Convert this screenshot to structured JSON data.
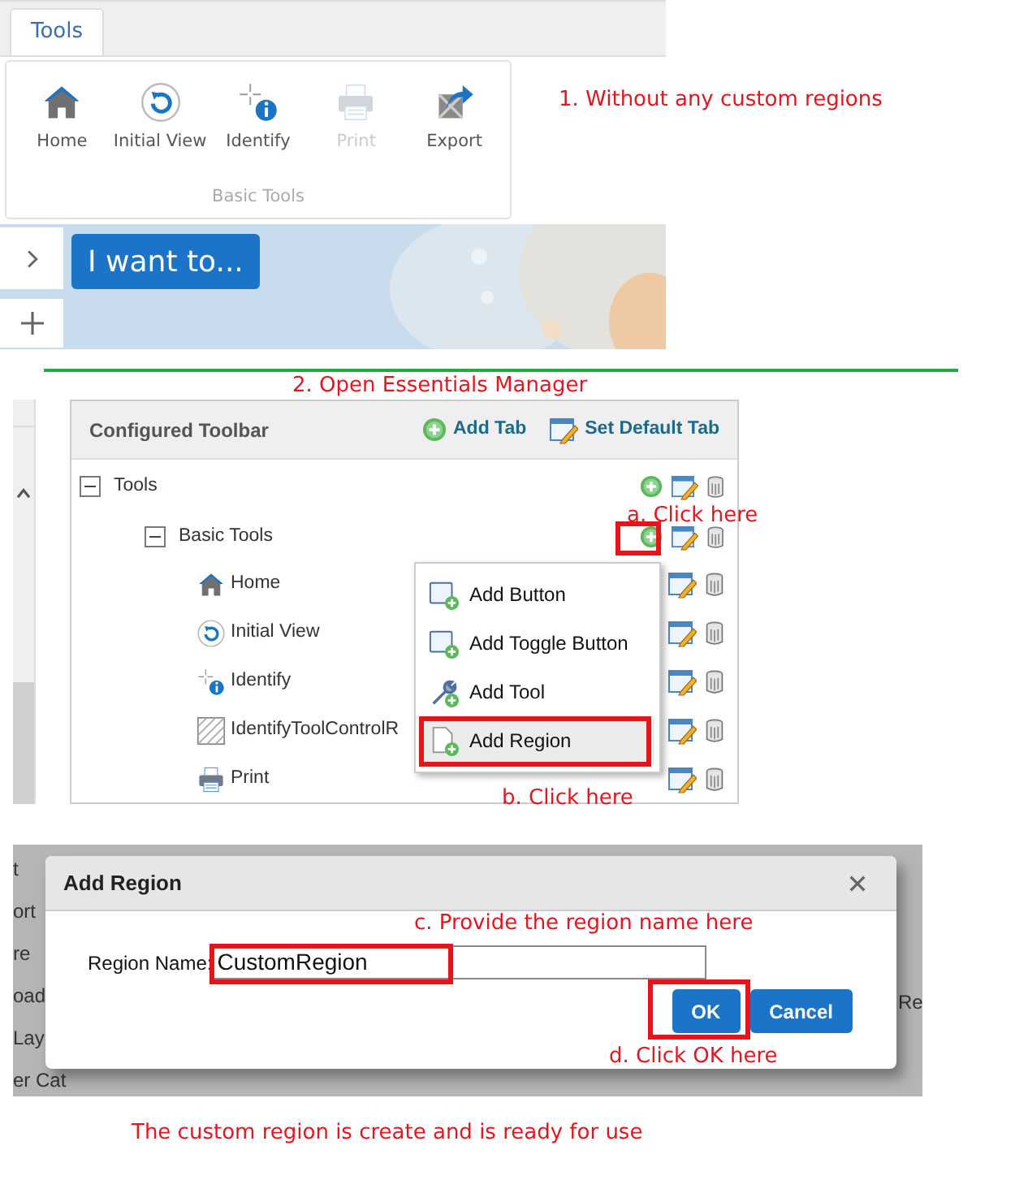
{
  "step1": {
    "tabs": [
      {
        "label": "Tools",
        "selected": true
      }
    ],
    "tools": [
      {
        "label": "Home",
        "kind": "home",
        "disabled": false
      },
      {
        "label": "Initial View",
        "kind": "refresh",
        "disabled": false
      },
      {
        "label": "Identify",
        "kind": "identify",
        "disabled": false
      },
      {
        "label": "Print",
        "kind": "print",
        "disabled": true
      },
      {
        "label": "Export",
        "kind": "export",
        "disabled": false
      }
    ],
    "group_label": "Basic Tools",
    "menu_button": "I want to...",
    "annotation": "1. Without any custom regions"
  },
  "step2": {
    "annotation": "2. Open Essentials Manager",
    "panel": {
      "title": "Configured Toolbar",
      "actions": [
        {
          "label": "Add Tab",
          "kind": "add"
        },
        {
          "label": "Set Default Tab",
          "kind": "edit"
        }
      ],
      "tree": [
        {
          "label": "Tools",
          "expanded": true,
          "children": [
            {
              "label": "Basic Tools",
              "expanded": true,
              "children": [
                {
                  "label": "Home",
                  "kind": "home"
                },
                {
                  "label": "Initial View",
                  "kind": "refresh"
                },
                {
                  "label": "Identify",
                  "kind": "identify"
                },
                {
                  "label": "IdentifyToolControlR",
                  "kind": "region"
                },
                {
                  "label": "Print",
                  "kind": "print"
                }
              ]
            }
          ]
        }
      ]
    },
    "context_menu": [
      {
        "label": "Add Button",
        "kind": "button",
        "selected": false
      },
      {
        "label": "Add Toggle Button",
        "kind": "button",
        "selected": false
      },
      {
        "label": "Add Tool",
        "kind": "tool",
        "selected": false
      },
      {
        "label": "Add Region",
        "kind": "region",
        "selected": true
      }
    ],
    "annotations": [
      "a. Click here",
      "b. Click here"
    ]
  },
  "step3": {
    "background_left": [
      "t",
      "ort",
      "re",
      "oad",
      "Lay",
      "er Cat"
    ],
    "background_right": [
      "Re"
    ],
    "dialog": {
      "title": "Add Region",
      "field": {
        "label": "Region Name:",
        "value": "CustomRegion"
      },
      "buttons": [
        "OK",
        "Cancel"
      ]
    },
    "annotations": [
      "c. Provide the region name here",
      "d. Click OK here"
    ]
  },
  "footer": "The custom region is create and is ready for use"
}
